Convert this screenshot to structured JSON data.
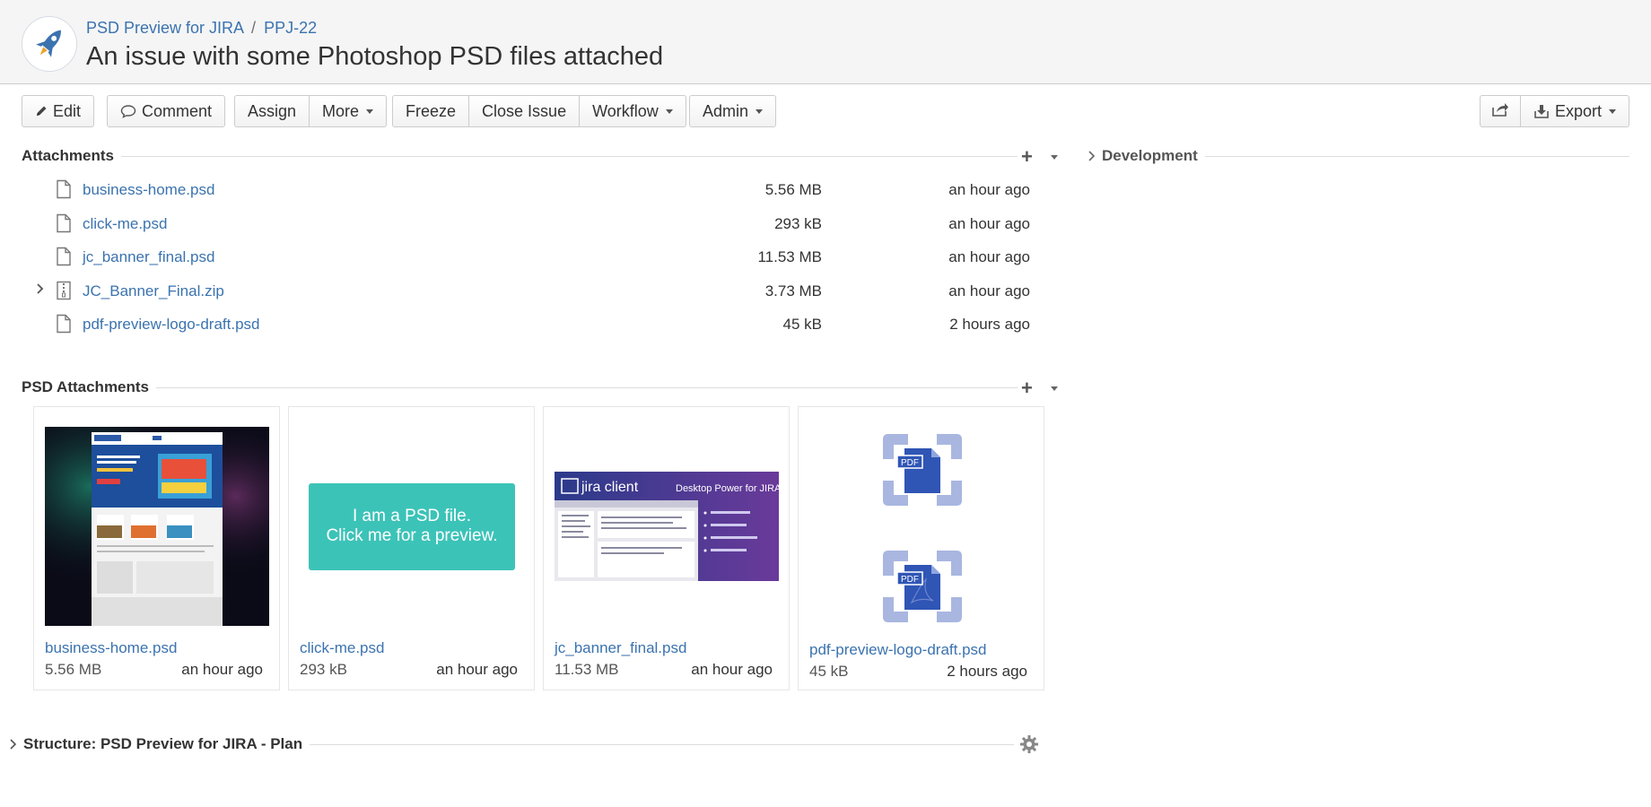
{
  "header": {
    "breadcrumb_project": "PSD Preview for JIRA",
    "breadcrumb_separator": "/",
    "breadcrumb_issue": "PPJ-22",
    "title": "An issue with some Photoshop PSD files attached"
  },
  "toolbar": {
    "edit": "Edit",
    "comment": "Comment",
    "assign": "Assign",
    "more": "More",
    "freeze": "Freeze",
    "close_issue": "Close Issue",
    "workflow": "Workflow",
    "admin": "Admin",
    "export": "Export"
  },
  "attachments": {
    "heading": "Attachments",
    "items": [
      {
        "name": "business-home.psd",
        "size": "5.56 MB",
        "date": "an hour ago",
        "type": "file"
      },
      {
        "name": "click-me.psd",
        "size": "293 kB",
        "date": "an hour ago",
        "type": "file"
      },
      {
        "name": "jc_banner_final.psd",
        "size": "11.53 MB",
        "date": "an hour ago",
        "type": "file"
      },
      {
        "name": "JC_Banner_Final.zip",
        "size": "3.73 MB",
        "date": "an hour ago",
        "type": "zip"
      },
      {
        "name": "pdf-preview-logo-draft.psd",
        "size": "45 kB",
        "date": "2 hours ago",
        "type": "file"
      }
    ]
  },
  "psd_attachments": {
    "heading": "PSD Attachments",
    "cards": [
      {
        "name": "business-home.psd",
        "size": "5.56 MB",
        "date": "an hour ago"
      },
      {
        "name": "click-me.psd",
        "size": "293 kB",
        "date": "an hour ago",
        "preview_line1": "I am a PSD file.",
        "preview_line2": "Click me for a preview."
      },
      {
        "name": "jc_banner_final.psd",
        "size": "11.53 MB",
        "date": "an hour ago"
      },
      {
        "name": "pdf-preview-logo-draft.psd",
        "size": "45 kB",
        "date": "2 hours ago"
      }
    ],
    "thumb_text": {
      "jira_client": "jira client",
      "desktop_power": "Desktop Power for JIRA",
      "pdf": "PDF"
    }
  },
  "development": {
    "heading": "Development"
  },
  "structure": {
    "heading": "Structure: PSD Preview for JIRA - Plan"
  },
  "colors": {
    "link": "#3b73af",
    "teal": "#3cc3b8",
    "header_bg": "#f5f5f5"
  }
}
